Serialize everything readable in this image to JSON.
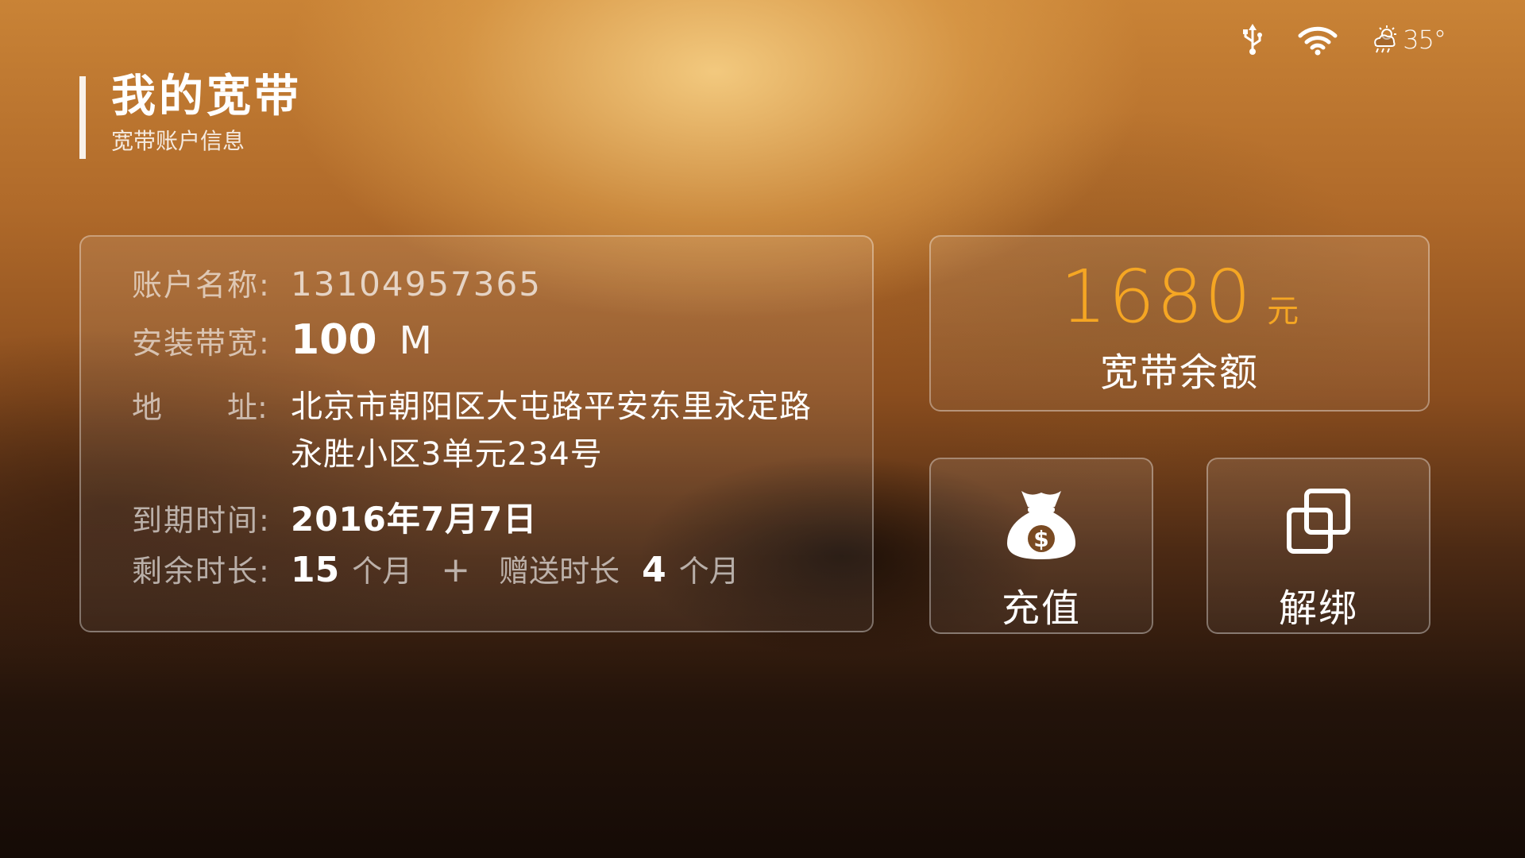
{
  "status_bar": {
    "icons": [
      "usb-icon",
      "wifi-icon",
      "weather-icon"
    ],
    "temperature": "35°"
  },
  "header": {
    "title": "我的宽带",
    "subtitle": "宽带账户信息"
  },
  "account": {
    "name_label": "账户名称:",
    "name_value": "13104957365",
    "bandwidth_label": "安装带宽:",
    "bandwidth_value": "100",
    "bandwidth_unit": "M",
    "address_label_left": "地",
    "address_label_right": "址:",
    "address_value": "北京市朝阳区大屯路平安东里永定路永胜小区3单元234号",
    "expiry_label": "到期时间:",
    "expiry_value": "2016年7月7日",
    "remaining_label": "剩余时长:",
    "remaining_value": "15",
    "remaining_unit": "个月",
    "plus": "+",
    "bonus_label": "赠送时长",
    "bonus_value": "4",
    "bonus_unit": "个月"
  },
  "balance": {
    "amount": "1680",
    "unit": "元",
    "label": "宽带余额"
  },
  "actions": {
    "recharge_label": "充值",
    "unbind_label": "解绑",
    "recharge_icon": "money-bag-icon",
    "unbind_icon": "unbind-icon"
  },
  "colors": {
    "accent": "#f5a623"
  }
}
